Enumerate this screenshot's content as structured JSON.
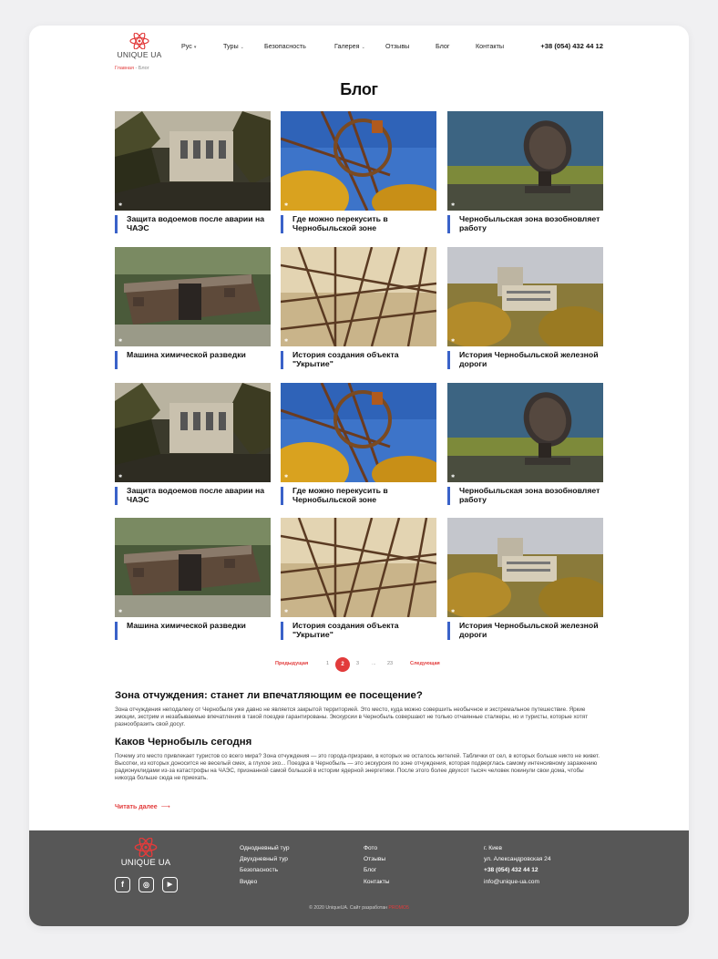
{
  "header": {
    "logo_text": "UNIQUE UA",
    "nav": [
      {
        "label": "Рус",
        "chevron": true
      },
      {
        "label": "Туры",
        "chevron": true
      },
      {
        "label": "Безопасность",
        "chevron": false
      },
      {
        "label": "Галерея",
        "chevron": true
      },
      {
        "label": "Отзывы",
        "chevron": false
      },
      {
        "label": "Блог",
        "chevron": false
      },
      {
        "label": "Контакты",
        "chevron": false
      }
    ],
    "phone": "+38 (054) 432 44 12"
  },
  "breadcrumb": {
    "home": "Главная",
    "separator": " - ",
    "current": "Блог"
  },
  "page_title": "Блог",
  "posts": [
    {
      "title": "Защита водоемов после аварии на ЧАЭС",
      "image": "abandoned-building"
    },
    {
      "title": "Где можно перекусить в Чернобыльской зоне",
      "image": "ferris-wheel"
    },
    {
      "title": "Чернобыльская зона возобновляет работу",
      "image": "radar-dish"
    },
    {
      "title": "Машина химической разведки",
      "image": "rusted-railcar"
    },
    {
      "title": "История создания объекта \"Укрытие\"",
      "image": "ferris-wheel-structure"
    },
    {
      "title": "История Чернобыльской железной дороги",
      "image": "pripyat-aerial"
    },
    {
      "title": "Защита водоемов после аварии на ЧАЭС",
      "image": "abandoned-building"
    },
    {
      "title": "Где можно перекусить в Чернобыльской зоне",
      "image": "ferris-wheel"
    },
    {
      "title": "Чернобыльская зона возобновляет работу",
      "image": "radar-dish"
    },
    {
      "title": "Машина химической разведки",
      "image": "rusted-railcar"
    },
    {
      "title": "История создания объекта \"Укрытие\"",
      "image": "ferris-wheel-structure"
    },
    {
      "title": "История Чернобыльской железной дороги",
      "image": "pripyat-aerial"
    }
  ],
  "pagination": {
    "prev": "Предыдущая",
    "pages": [
      "1",
      "2",
      "3",
      "...",
      "23"
    ],
    "active": "2",
    "next": "Следующая"
  },
  "article": {
    "heading1": "Зона отчуждения: станет ли впечатляющим ее посещение?",
    "para1": "Зона отчуждения неподалеку от Чернобыля уже давно не является закрытой территорией. Это место, куда можно совершить необычное и экстремальное путешествие. Яркие эмоции, экстрим и незабываемые впечатления в такой поездке гарантированы. Экскурсии в Чернобыль совершают не только отчаянные сталкеры, но и туристы, которые хотят разнообразить свой досуг.",
    "heading2": "Каков Чернобыль сегодня",
    "para2": "Почему это место привлекает туристов со всего мира? Зона отчуждения — это города-призраки, в которых не осталось жителей. Таблички от сел, в которых больше никто не живет. Высотки, из которых доносится не веселый смех, а глухое эхо... Поездка в Чернобыль — это экскурсия по зоне отчуждения, которая подверглась самому интенсивному заражению радионуклидами из-за катастрофы на ЧАЭС, признанной самой большой в истории ядерной энергетики. После этого более двухсот тысяч человек покинули свои дома, чтобы никогда больше сюда не приехать.",
    "read_more": "Читать далее",
    "read_more_arrow": "⟶"
  },
  "footer": {
    "logo_text": "UNIQUE UA",
    "socials": [
      {
        "icon": "facebook-icon",
        "glyph": "f"
      },
      {
        "icon": "instagram-icon",
        "glyph": "◎"
      },
      {
        "icon": "youtube-icon",
        "glyph": "▶"
      }
    ],
    "col1": [
      "Однодневный тур",
      "Двухдневный тур",
      "Безопасность",
      "Видео"
    ],
    "col2": [
      "Фото",
      "Отзывы",
      "Блог",
      "Контакты"
    ],
    "col3": [
      "г. Киев",
      "ул. Александровская 24",
      "+38 (054) 432 44 12",
      "info@unique-ua.com"
    ],
    "copyright": "© 2020 UniqueUA. Сайт разработан",
    "developer": "PROMO5"
  },
  "colors": {
    "accent": "#e23b3b",
    "title_bar": "#3a62c9",
    "footer_bg": "#575757"
  }
}
